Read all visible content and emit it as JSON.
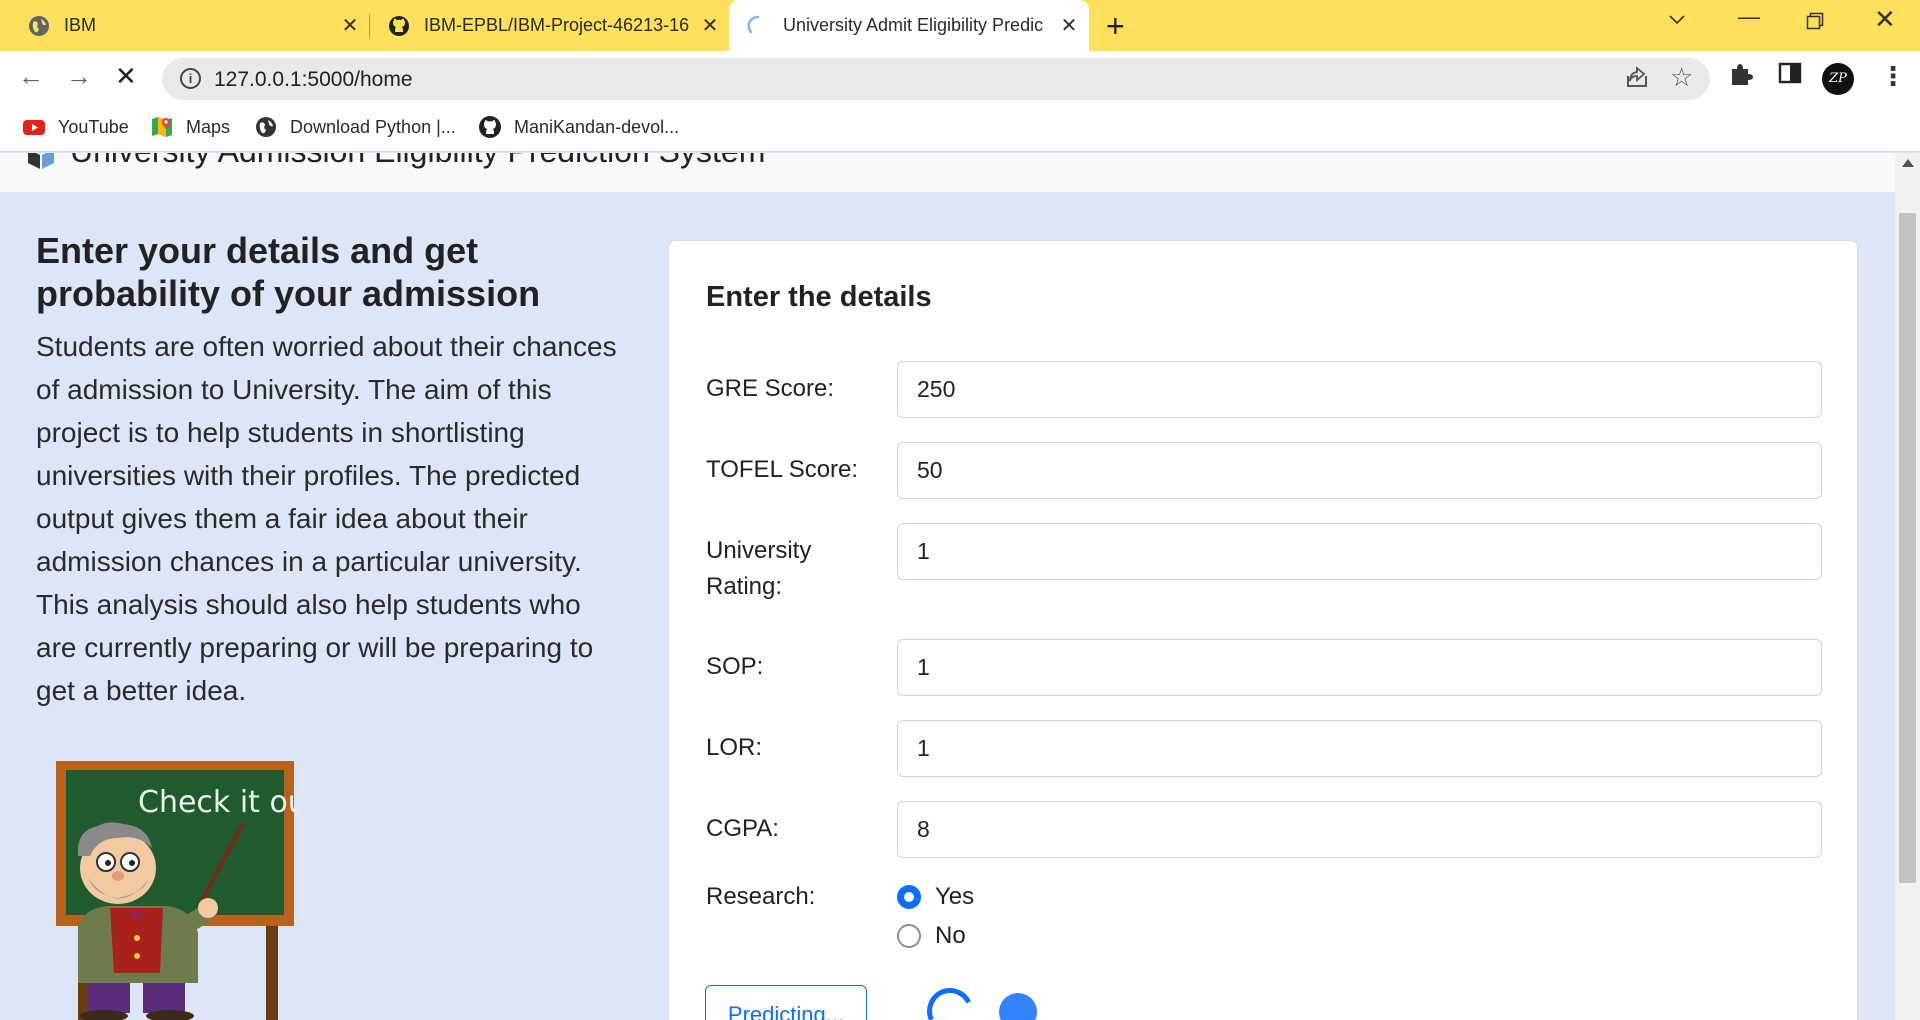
{
  "browser": {
    "tabs": [
      {
        "title": "IBM",
        "icon": "globe-icon",
        "active": false
      },
      {
        "title": "IBM-EPBL/IBM-Project-46213-16",
        "icon": "github-icon",
        "active": false
      },
      {
        "title": "University Admit Eligibility Predic",
        "icon": "loading-spinner-icon",
        "active": true
      }
    ],
    "url": "127.0.0.1:5000/home",
    "bookmarks": [
      {
        "label": "YouTube",
        "icon": "youtube-icon"
      },
      {
        "label": "Maps",
        "icon": "maps-icon"
      },
      {
        "label": "Download Python |...",
        "icon": "globe-icon"
      },
      {
        "label": "ManiKandan-devol...",
        "icon": "github-icon"
      }
    ],
    "profile_initials": "ZP"
  },
  "site": {
    "brand": "University Admission Eligibility Prediction System"
  },
  "hero": {
    "title": "Enter your details and get probability of your admission",
    "text": "Students are often worried about their chances of admission to University. The aim of this project is to help students in shortlisting universities with their profiles. The predicted output gives them a fair idea about their admission chances in a particular university. This analysis should also help students who are currently preparing or will be preparing to get a better idea.",
    "image_caption": "Check it out!"
  },
  "form": {
    "title": "Enter the details",
    "fields": {
      "gre": {
        "label": "GRE Score:",
        "value": "250"
      },
      "tofel": {
        "label": "TOFEL Score:",
        "value": "50"
      },
      "rating": {
        "label": "University Rating:",
        "value": "1"
      },
      "sop": {
        "label": "SOP:",
        "value": "1"
      },
      "lor": {
        "label": "LOR:",
        "value": "1"
      },
      "cgpa": {
        "label": "CGPA:",
        "value": "8"
      }
    },
    "research": {
      "label": "Research:",
      "options": [
        "Yes",
        "No"
      ],
      "selected": "Yes"
    },
    "button_label": "Predicting..."
  },
  "colors": {
    "accent": "#0d6efd",
    "tabstrip": "#fde05c",
    "page_bg": "#dde6f7"
  }
}
